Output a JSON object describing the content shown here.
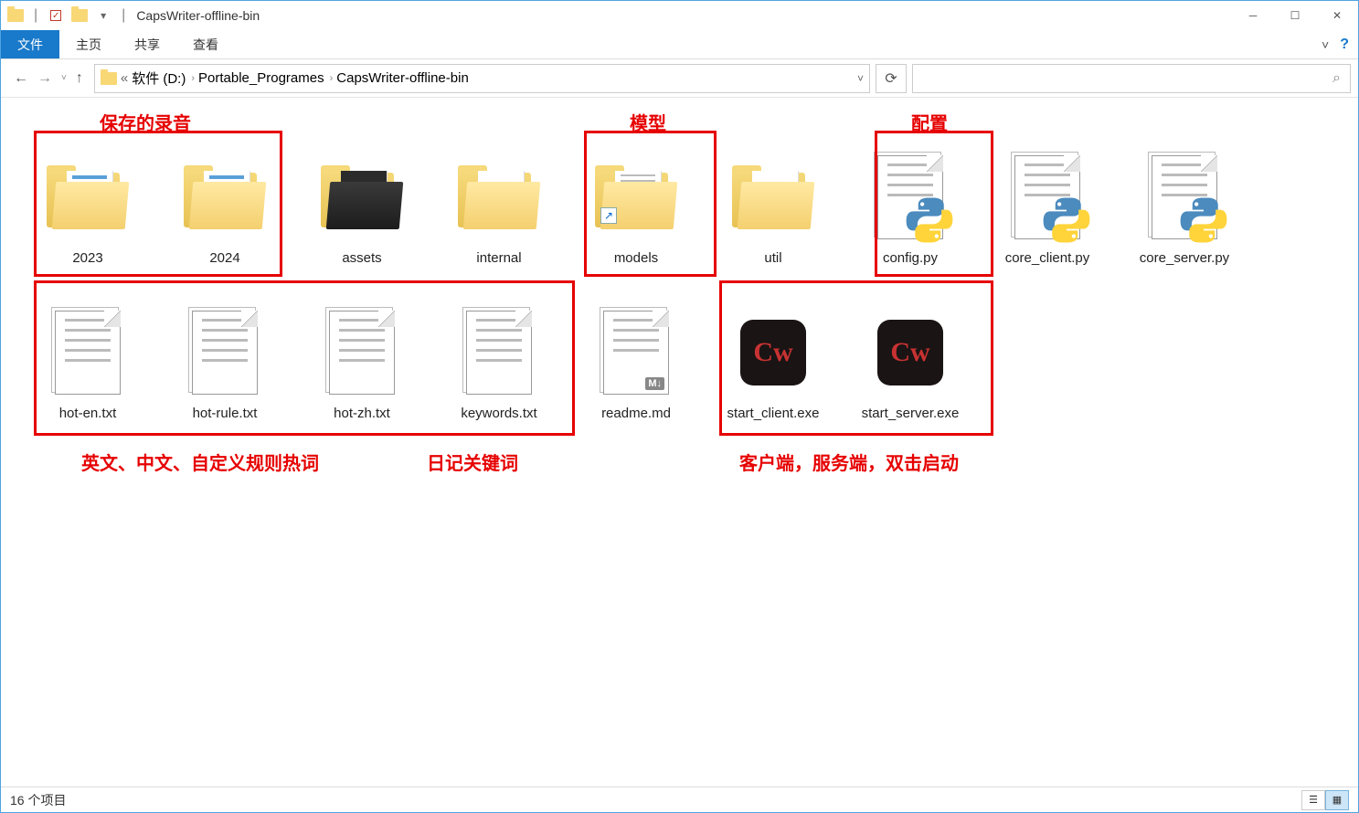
{
  "window": {
    "title": "CapsWriter-offline-bin"
  },
  "ribbon": {
    "file": "文件",
    "home": "主页",
    "share": "共享",
    "view": "查看"
  },
  "address": {
    "chevrons": "«",
    "drive": "软件 (D:)",
    "folder1": "Portable_Programes",
    "folder2": "CapsWriter-offline-bin"
  },
  "annotations": {
    "recordings": "保存的录音",
    "models": "模型",
    "config": "配置",
    "hotwords": "英文、中文、自定义规则热词",
    "keywords": "日记关键词",
    "launchers": "客户端，服务端，双击启动"
  },
  "items": {
    "f2023": "2023",
    "f2024": "2024",
    "assets": "assets",
    "internal": "internal",
    "models": "models",
    "util": "util",
    "config": "config.py",
    "core_client": "core_client.py",
    "core_server": "core_server.py",
    "hot_en": "hot-en.txt",
    "hot_rule": "hot-rule.txt",
    "hot_zh": "hot-zh.txt",
    "keywords": "keywords.txt",
    "readme": "readme.md",
    "start_client": "start_client.exe",
    "start_server": "start_server.exe"
  },
  "status": {
    "count": "16 个项目"
  }
}
